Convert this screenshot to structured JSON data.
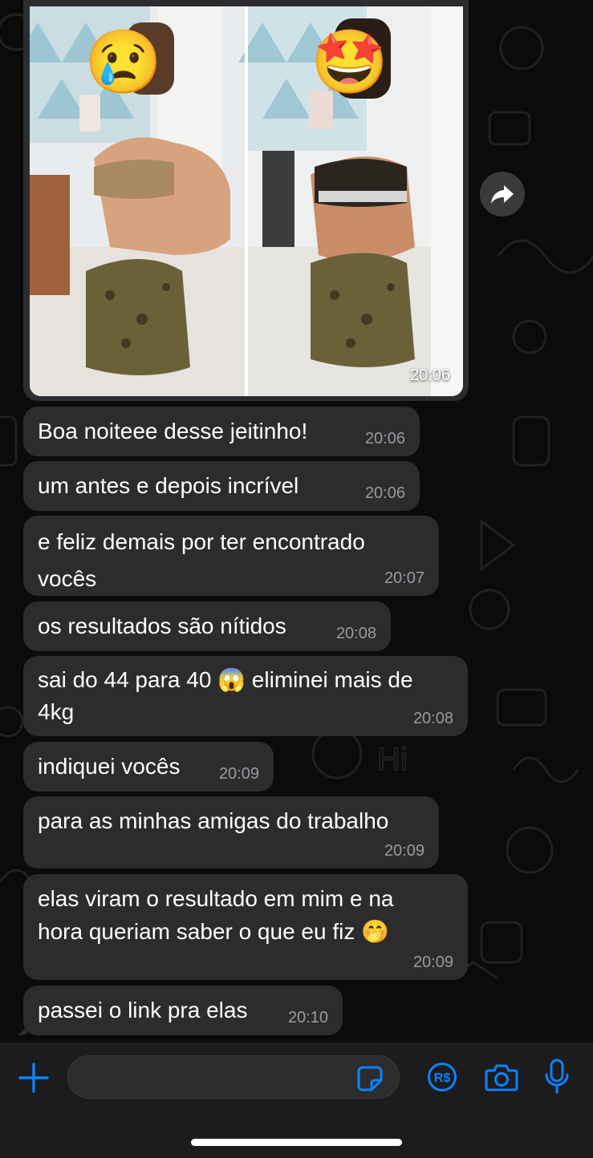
{
  "photo_message": {
    "time": "20:06",
    "before_emoji": "😢",
    "after_emoji": "🤩"
  },
  "messages": [
    {
      "text": "Boa noiteee desse jeitinho!",
      "time": "20:06"
    },
    {
      "text": "um antes e depois incrível",
      "time": "20:06"
    },
    {
      "text": "e feliz demais por ter encontrado\nvocês",
      "time": "20:07"
    },
    {
      "text": "os resultados são nítidos",
      "time": "20:08"
    },
    {
      "text": "sai do 44 para 40 😱 eliminei mais de\n4kg",
      "time": "20:08"
    },
    {
      "text": "indiquei vocês",
      "time": "20:09"
    },
    {
      "text": "para as minhas amigas do trabalho",
      "time": "20:09"
    },
    {
      "text": "elas viram o resultado em mim e na\nhora queriam saber o que eu fiz 🤭",
      "time": "20:09"
    },
    {
      "text": "passei o link pra elas",
      "time": "20:10"
    }
  ],
  "composer": {
    "input_value": "",
    "icons": [
      "plus-icon",
      "sticker-icon",
      "pix-icon",
      "camera-icon",
      "microphone-icon"
    ]
  },
  "colors": {
    "background": "#0b0b0b",
    "bubble": "#2c2c2e",
    "accent": "#0a84ff",
    "timestamp": "#9a9a9f"
  }
}
